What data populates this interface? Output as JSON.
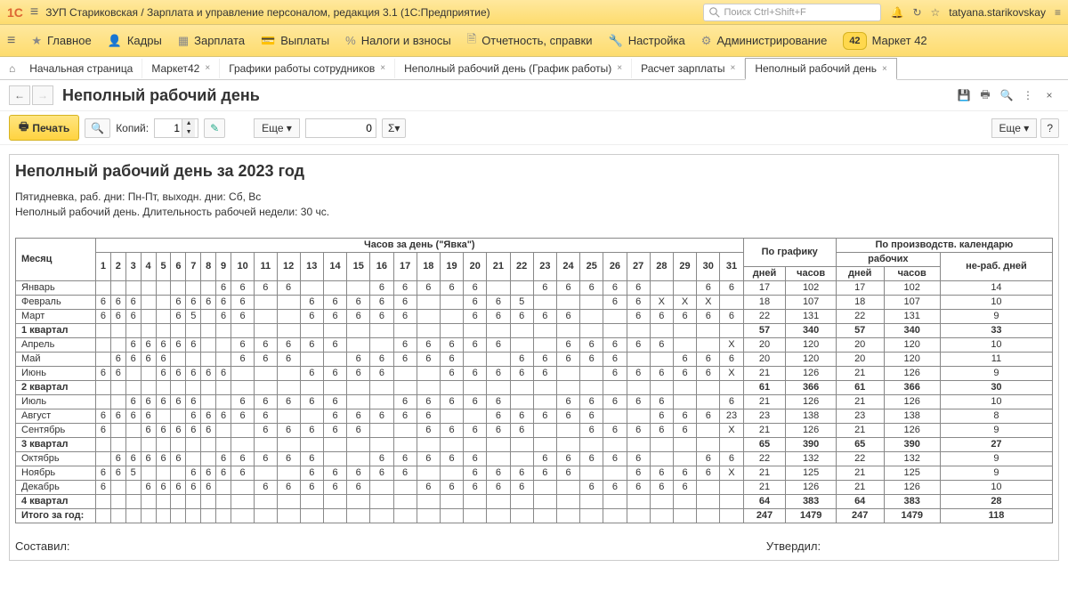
{
  "header": {
    "logo": "1С",
    "app_title": "ЗУП Стариковская / Зарплата и управление персоналом, редакция 3.1 (1С:Предприятие)",
    "search_placeholder": "Поиск Ctrl+Shift+F",
    "username": "tatyana.starikovskay"
  },
  "nav": [
    {
      "label": "Главное"
    },
    {
      "label": "Кадры"
    },
    {
      "label": "Зарплата"
    },
    {
      "label": "Выплаты"
    },
    {
      "label": "Налоги и взносы"
    },
    {
      "label": "Отчетность, справки"
    },
    {
      "label": "Настройка"
    },
    {
      "label": "Администрирование"
    },
    {
      "badge": "42",
      "label": "Маркет 42"
    }
  ],
  "tabs": {
    "start": "Начальная страница",
    "items": [
      {
        "label": "Маркет42"
      },
      {
        "label": "Графики работы сотрудников"
      },
      {
        "label": "Неполный рабочий день (График работы)"
      },
      {
        "label": "Расчет зарплаты"
      },
      {
        "label": "Неполный рабочий день",
        "active": true
      }
    ]
  },
  "page": {
    "title": "Неполный рабочий день"
  },
  "toolbar": {
    "print": "Печать",
    "copies_label": "Копий:",
    "copies_value": "1",
    "more": "Еще",
    "num_value": "0",
    "sigma": "Σ",
    "more_right": "Еще",
    "help": "?"
  },
  "report": {
    "title": "Неполный рабочий день за 2023 год",
    "sub1": "Пятидневка, раб. дни: Пн-Пт, выходн. дни: Сб, Вс",
    "sub2": "Неполный рабочий день. Длительность рабочей недели: 30 чс.",
    "col_month": "Месяц",
    "col_hours": "Часов за день (\"Явка\")",
    "col_sched": "По графику",
    "col_prod": "По производств. календарю",
    "col_work": "рабочих",
    "col_nonwork": "не-раб. дней",
    "col_days": "дней",
    "col_hrs": "часов",
    "signatures": {
      "left": "Составил:",
      "right": "Утвердил:"
    },
    "rows": [
      {
        "m": "Январь",
        "d": [
          "",
          "",
          "",
          "",
          "",
          "",
          "",
          "",
          "6",
          "6",
          "6",
          "6",
          "",
          "",
          "",
          "6",
          "6",
          "6",
          "6",
          "6",
          "",
          "",
          "6",
          "6",
          "6",
          "6",
          "6",
          "",
          "",
          "6",
          "6"
        ],
        "gd": "17",
        "gh": "102",
        "pd": "17",
        "ph": "102",
        "nr": "14"
      },
      {
        "m": "Февраль",
        "d": [
          "6",
          "6",
          "6",
          "",
          "",
          "6",
          "6",
          "6",
          "6",
          "6",
          "",
          "",
          "6",
          "6",
          "6",
          "6",
          "6",
          "",
          "",
          "6",
          "6",
          "5",
          "",
          "",
          "",
          "6",
          "6",
          "X",
          "X",
          "X",
          ""
        ],
        "gd": "18",
        "gh": "107",
        "pd": "18",
        "ph": "107",
        "nr": "10"
      },
      {
        "m": "Март",
        "d": [
          "6",
          "6",
          "6",
          "",
          "",
          "6",
          "5",
          "",
          "6",
          "6",
          "",
          "",
          "6",
          "6",
          "6",
          "6",
          "6",
          "",
          "",
          "6",
          "6",
          "6",
          "6",
          "6",
          "",
          "",
          "6",
          "6",
          "6",
          "6",
          "6"
        ],
        "gd": "22",
        "gh": "131",
        "pd": "22",
        "ph": "131",
        "nr": "9"
      },
      {
        "m": "1 квартал",
        "d": [
          "",
          "",
          "",
          "",
          "",
          "",
          "",
          "",
          "",
          "",
          "",
          "",
          "",
          "",
          "",
          "",
          "",
          "",
          "",
          "",
          "",
          "",
          "",
          "",
          "",
          "",
          "",
          "",
          "",
          "",
          ""
        ],
        "gd": "57",
        "gh": "340",
        "pd": "57",
        "ph": "340",
        "nr": "33",
        "qtr": true
      },
      {
        "m": "Апрель",
        "d": [
          "",
          "",
          "6",
          "6",
          "6",
          "6",
          "6",
          "",
          "",
          "6",
          "6",
          "6",
          "6",
          "6",
          "",
          "",
          "6",
          "6",
          "6",
          "6",
          "6",
          "",
          "",
          "6",
          "6",
          "6",
          "6",
          "6",
          "",
          "",
          "X"
        ],
        "gd": "20",
        "gh": "120",
        "pd": "20",
        "ph": "120",
        "nr": "10"
      },
      {
        "m": "Май",
        "d": [
          "",
          "6",
          "6",
          "6",
          "6",
          "",
          "",
          "",
          "",
          "6",
          "6",
          "6",
          "",
          "",
          "6",
          "6",
          "6",
          "6",
          "6",
          "",
          "",
          "6",
          "6",
          "6",
          "6",
          "6",
          "",
          "",
          "6",
          "6",
          "6"
        ],
        "gd": "20",
        "gh": "120",
        "pd": "20",
        "ph": "120",
        "nr": "11"
      },
      {
        "m": "Июнь",
        "d": [
          "6",
          "6",
          "",
          "",
          "6",
          "6",
          "6",
          "6",
          "6",
          "",
          "",
          "",
          "6",
          "6",
          "6",
          "6",
          "",
          "",
          "6",
          "6",
          "6",
          "6",
          "6",
          "",
          "",
          "6",
          "6",
          "6",
          "6",
          "6",
          "X"
        ],
        "gd": "21",
        "gh": "126",
        "pd": "21",
        "ph": "126",
        "nr": "9"
      },
      {
        "m": "2 квартал",
        "d": [
          "",
          "",
          "",
          "",
          "",
          "",
          "",
          "",
          "",
          "",
          "",
          "",
          "",
          "",
          "",
          "",
          "",
          "",
          "",
          "",
          "",
          "",
          "",
          "",
          "",
          "",
          "",
          "",
          "",
          "",
          ""
        ],
        "gd": "61",
        "gh": "366",
        "pd": "61",
        "ph": "366",
        "nr": "30",
        "qtr": true
      },
      {
        "m": "Июль",
        "d": [
          "",
          "",
          "6",
          "6",
          "6",
          "6",
          "6",
          "",
          "",
          "6",
          "6",
          "6",
          "6",
          "6",
          "",
          "",
          "6",
          "6",
          "6",
          "6",
          "6",
          "",
          "",
          "6",
          "6",
          "6",
          "6",
          "6",
          "",
          "",
          "6"
        ],
        "gd": "21",
        "gh": "126",
        "pd": "21",
        "ph": "126",
        "nr": "10"
      },
      {
        "m": "Август",
        "d": [
          "6",
          "6",
          "6",
          "6",
          "",
          "",
          "6",
          "6",
          "6",
          "6",
          "6",
          "",
          "",
          "6",
          "6",
          "6",
          "6",
          "6",
          "",
          "",
          "6",
          "6",
          "6",
          "6",
          "6",
          "",
          "",
          "6",
          "6",
          "6",
          "23"
        ],
        "gd": "23",
        "gh": "138",
        "pd": "23",
        "ph": "138",
        "nr": "8"
      },
      {
        "m": "Сентябрь",
        "d": [
          "6",
          "",
          "",
          "6",
          "6",
          "6",
          "6",
          "6",
          "",
          "",
          "6",
          "6",
          "6",
          "6",
          "6",
          "",
          "",
          "6",
          "6",
          "6",
          "6",
          "6",
          "",
          "",
          "6",
          "6",
          "6",
          "6",
          "6",
          "",
          "X"
        ],
        "gd": "21",
        "gh": "126",
        "pd": "21",
        "ph": "126",
        "nr": "9"
      },
      {
        "m": "3 квартал",
        "d": [
          "",
          "",
          "",
          "",
          "",
          "",
          "",
          "",
          "",
          "",
          "",
          "",
          "",
          "",
          "",
          "",
          "",
          "",
          "",
          "",
          "",
          "",
          "",
          "",
          "",
          "",
          "",
          "",
          "",
          "",
          ""
        ],
        "gd": "65",
        "gh": "390",
        "pd": "65",
        "ph": "390",
        "nr": "27",
        "qtr": true
      },
      {
        "m": "Октябрь",
        "d": [
          "",
          "6",
          "6",
          "6",
          "6",
          "6",
          "",
          "",
          "6",
          "6",
          "6",
          "6",
          "6",
          "",
          "",
          "6",
          "6",
          "6",
          "6",
          "6",
          "",
          "",
          "6",
          "6",
          "6",
          "6",
          "6",
          "",
          "",
          "6",
          "6"
        ],
        "gd": "22",
        "gh": "132",
        "pd": "22",
        "ph": "132",
        "nr": "9"
      },
      {
        "m": "Ноябрь",
        "d": [
          "6",
          "6",
          "5",
          "",
          "",
          "",
          "6",
          "6",
          "6",
          "6",
          "",
          "",
          "6",
          "6",
          "6",
          "6",
          "6",
          "",
          "",
          "6",
          "6",
          "6",
          "6",
          "6",
          "",
          "",
          "6",
          "6",
          "6",
          "6",
          "X"
        ],
        "gd": "21",
        "gh": "125",
        "pd": "21",
        "ph": "125",
        "nr": "9"
      },
      {
        "m": "Декабрь",
        "d": [
          "6",
          "",
          "",
          "6",
          "6",
          "6",
          "6",
          "6",
          "",
          "",
          "6",
          "6",
          "6",
          "6",
          "6",
          "",
          "",
          "6",
          "6",
          "6",
          "6",
          "6",
          "",
          "",
          "6",
          "6",
          "6",
          "6",
          "6",
          "",
          ""
        ],
        "gd": "21",
        "gh": "126",
        "pd": "21",
        "ph": "126",
        "nr": "10"
      },
      {
        "m": "4 квартал",
        "d": [
          "",
          "",
          "",
          "",
          "",
          "",
          "",
          "",
          "",
          "",
          "",
          "",
          "",
          "",
          "",
          "",
          "",
          "",
          "",
          "",
          "",
          "",
          "",
          "",
          "",
          "",
          "",
          "",
          "",
          "",
          ""
        ],
        "gd": "64",
        "gh": "383",
        "pd": "64",
        "ph": "383",
        "nr": "28",
        "qtr": true
      },
      {
        "m": "Итого за год:",
        "d": [
          "",
          "",
          "",
          "",
          "",
          "",
          "",
          "",
          "",
          "",
          "",
          "",
          "",
          "",
          "",
          "",
          "",
          "",
          "",
          "",
          "",
          "",
          "",
          "",
          "",
          "",
          "",
          "",
          "",
          "",
          ""
        ],
        "gd": "247",
        "gh": "1479",
        "pd": "247",
        "ph": "1479",
        "nr": "118",
        "qtr": true
      }
    ]
  }
}
